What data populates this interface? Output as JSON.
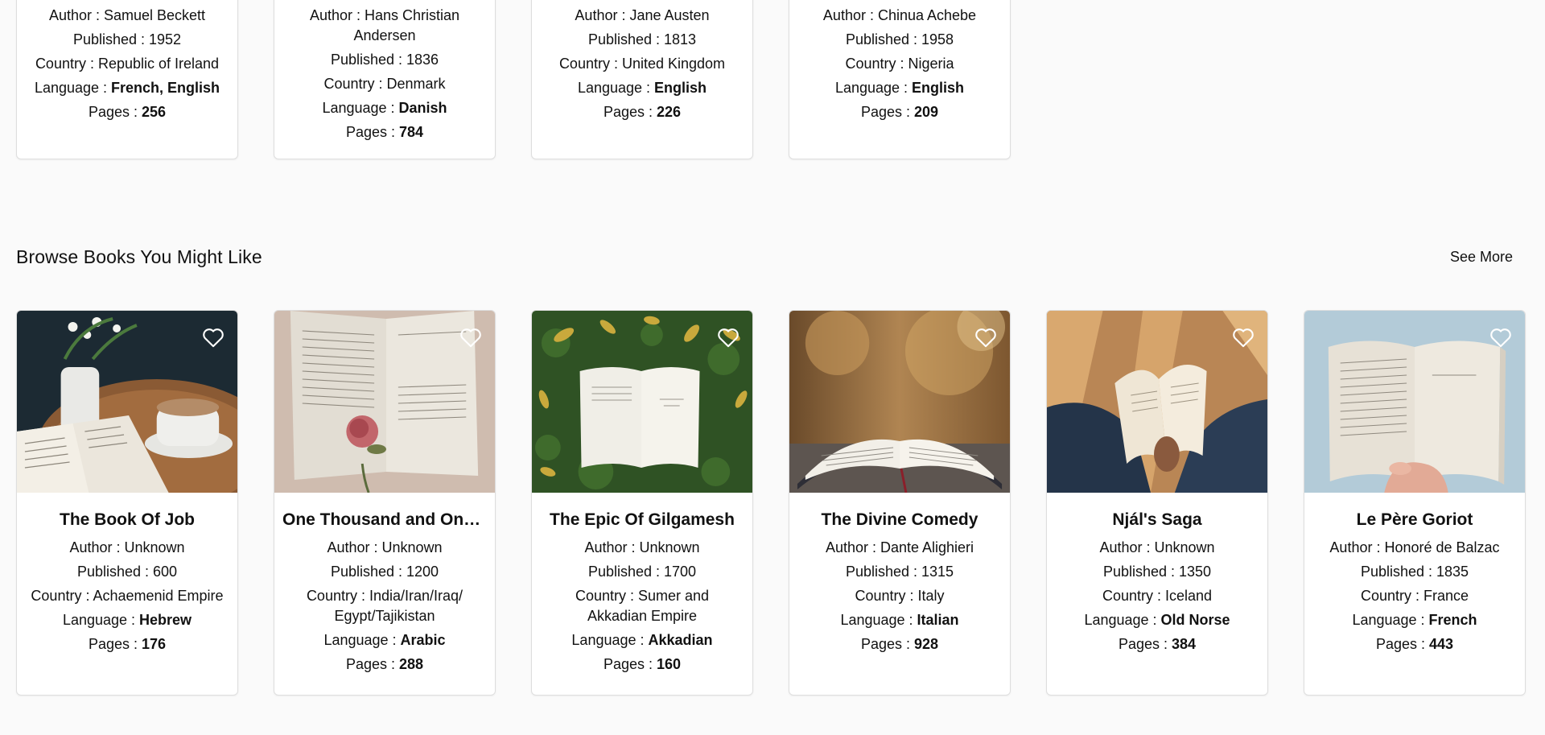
{
  "top_row": [
    {
      "author_label": "Author : ",
      "author": "Samuel Beckett",
      "published_label": "Published : ",
      "published": "1952",
      "country_label": "Country : ",
      "country": "Republic of Ireland",
      "language_label": "Language : ",
      "language": "French, English",
      "pages_label": "Pages : ",
      "pages": "256"
    },
    {
      "author_label": "Author : ",
      "author": "Hans Christian Andersen",
      "published_label": "Published : ",
      "published": "1836",
      "country_label": "Country : ",
      "country": "Denmark",
      "language_label": "Language : ",
      "language": "Danish",
      "pages_label": "Pages : ",
      "pages": "784"
    },
    {
      "author_label": "Author : ",
      "author": "Jane Austen",
      "published_label": "Published : ",
      "published": "1813",
      "country_label": "Country : ",
      "country": "United Kingdom",
      "language_label": "Language : ",
      "language": "English",
      "pages_label": "Pages : ",
      "pages": "226"
    },
    {
      "author_label": "Author : ",
      "author": "Chinua Achebe",
      "published_label": "Published : ",
      "published": "1958",
      "country_label": "Country : ",
      "country": "Nigeria",
      "language_label": "Language : ",
      "language": "English",
      "pages_label": "Pages : ",
      "pages": "209"
    }
  ],
  "browse": {
    "title": "Browse Books You Might Like",
    "see_more": "See More",
    "books": [
      {
        "title": "The Book Of Job",
        "author_label": "Author : ",
        "author": "Unknown",
        "published_label": "Published : ",
        "published": "600",
        "country_label": "Country : ",
        "country": "Achaemenid Empire",
        "language_label": "Language : ",
        "language": "Hebrew",
        "pages_label": "Pages : ",
        "pages": "176",
        "icon": "heart-outline-icon"
      },
      {
        "title": "One Thousand and One ...",
        "author_label": "Author : ",
        "author": "Unknown",
        "published_label": "Published : ",
        "published": "1200",
        "country_label": "Country : ",
        "country": "India/Iran/Iraq/ Egypt/Tajikistan",
        "language_label": "Language : ",
        "language": "Arabic",
        "pages_label": "Pages : ",
        "pages": "288",
        "icon": "heart-outline-icon"
      },
      {
        "title": "The Epic Of Gilgamesh",
        "author_label": "Author : ",
        "author": "Unknown",
        "published_label": "Published : ",
        "published": "1700",
        "country_label": "Country : ",
        "country": "Sumer and Akkadian Empire",
        "language_label": "Language : ",
        "language": "Akkadian",
        "pages_label": "Pages : ",
        "pages": "160",
        "icon": "heart-outline-icon"
      },
      {
        "title": "The Divine Comedy",
        "author_label": "Author : ",
        "author": "Dante Alighieri",
        "published_label": "Published : ",
        "published": "1315",
        "country_label": "Country : ",
        "country": "Italy",
        "language_label": "Language : ",
        "language": "Italian",
        "pages_label": "Pages : ",
        "pages": "928",
        "icon": "heart-outline-icon"
      },
      {
        "title": "Njál's Saga",
        "author_label": "Author : ",
        "author": "Unknown",
        "published_label": "Published : ",
        "published": "1350",
        "country_label": "Country : ",
        "country": "Iceland",
        "language_label": "Language : ",
        "language": "Old Norse",
        "pages_label": "Pages : ",
        "pages": "384",
        "icon": "heart-outline-icon"
      },
      {
        "title": "Le Père Goriot",
        "author_label": "Author : ",
        "author": "Honoré de Balzac",
        "published_label": "Published : ",
        "published": "1835",
        "country_label": "Country : ",
        "country": "France",
        "language_label": "Language : ",
        "language": "French",
        "pages_label": "Pages : ",
        "pages": "443",
        "icon": "heart-outline-icon"
      }
    ]
  },
  "colors": {
    "background": "#fafafa",
    "card": "#ffffff",
    "card_border": "#dedede",
    "text": "#111111"
  }
}
